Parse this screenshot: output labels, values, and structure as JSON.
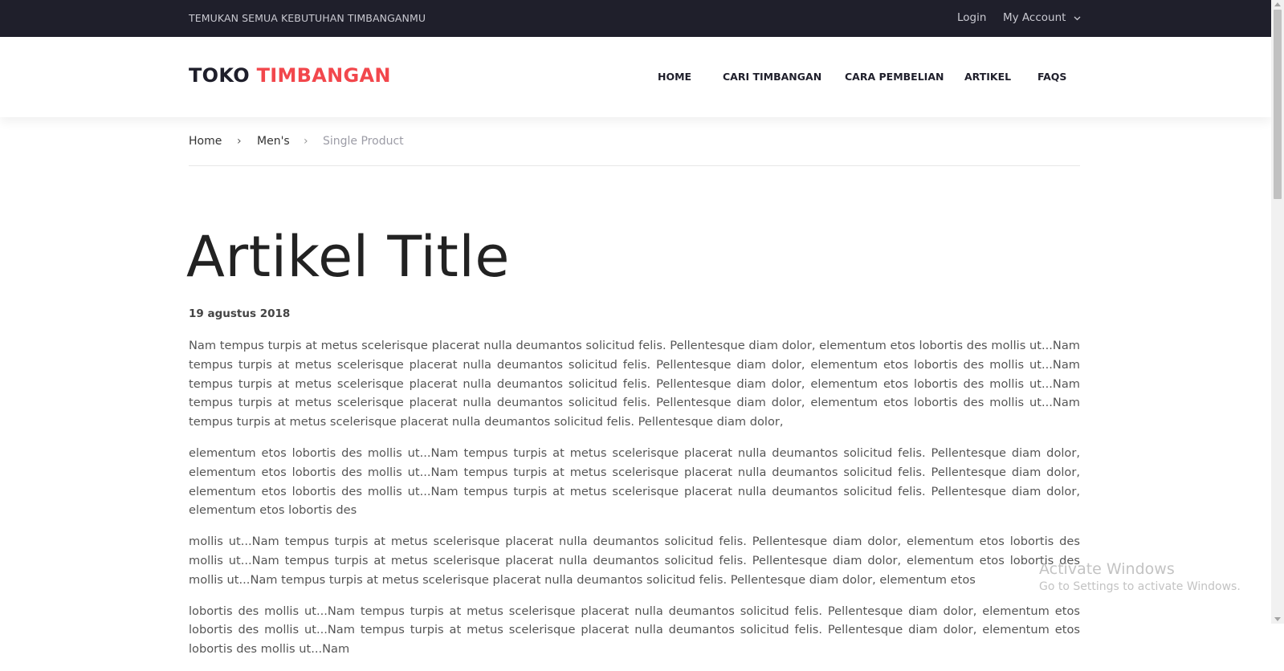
{
  "topbar": {
    "tagline": "TEMUKAN SEMUA KEBUTUHAN TIMBANGANMU",
    "login_label": "Login",
    "account_label": "My Account",
    "account_icon": "chevron-down-icon"
  },
  "header": {
    "logo_part1": "TOKO",
    "logo_part2": "TIMBANGAN",
    "nav": [
      {
        "label": "HOME"
      },
      {
        "label": "CARI TIMBANGAN"
      },
      {
        "label": "CARA PEMBELIAN"
      },
      {
        "label": "ARTIKEL"
      },
      {
        "label": "FAQS"
      }
    ]
  },
  "breadcrumb": {
    "items": [
      "Home",
      "Men's",
      "Single Product"
    ],
    "separator": "›"
  },
  "article": {
    "title": "Artikel Title",
    "date": "19 agustus 2018",
    "paragraphs": [
      "Nam tempus turpis at metus scelerisque placerat nulla deumantos solicitud felis. Pellentesque diam dolor, elementum etos lobortis des mollis ut...Nam tempus turpis at metus scelerisque placerat nulla deumantos solicitud felis. Pellentesque diam dolor, elementum etos lobortis des mollis ut...Nam tempus turpis at metus scelerisque placerat nulla deumantos solicitud felis. Pellentesque diam dolor, elementum etos lobortis des mollis ut...Nam tempus turpis at metus scelerisque placerat nulla deumantos solicitud felis. Pellentesque diam dolor, elementum etos lobortis des mollis ut...Nam tempus turpis at metus scelerisque placerat nulla deumantos solicitud felis. Pellentesque diam dolor,",
      "elementum etos lobortis des mollis ut...Nam tempus turpis at metus scelerisque placerat nulla deumantos solicitud felis. Pellentesque diam dolor, elementum etos lobortis des mollis ut...Nam tempus turpis at metus scelerisque placerat nulla deumantos solicitud felis. Pellentesque diam dolor, elementum etos lobortis des mollis ut...Nam tempus turpis at metus scelerisque placerat nulla deumantos solicitud felis. Pellentesque diam dolor, elementum etos lobortis des",
      "mollis ut...Nam tempus turpis at metus scelerisque placerat nulla deumantos solicitud felis. Pellentesque diam dolor, elementum etos lobortis des mollis ut...Nam tempus turpis at metus scelerisque placerat nulla deumantos solicitud felis. Pellentesque diam dolor, elementum etos lobortis des mollis ut...Nam tempus turpis at metus scelerisque placerat nulla deumantos solicitud felis. Pellentesque diam dolor, elementum etos",
      "lobortis des mollis ut...Nam tempus turpis at metus scelerisque placerat nulla deumantos solicitud felis. Pellentesque diam dolor, elementum etos lobortis des mollis ut...Nam tempus turpis at metus scelerisque placerat nulla deumantos solicitud felis. Pellentesque diam dolor, elementum etos lobortis des mollis ut...Nam"
    ]
  },
  "watermark": {
    "line1": "Activate Windows",
    "line2": "Go to Settings to activate Windows."
  },
  "colors": {
    "topbar_bg": "#1f1f2b",
    "accent": "#f2474c",
    "text": "#555555"
  }
}
